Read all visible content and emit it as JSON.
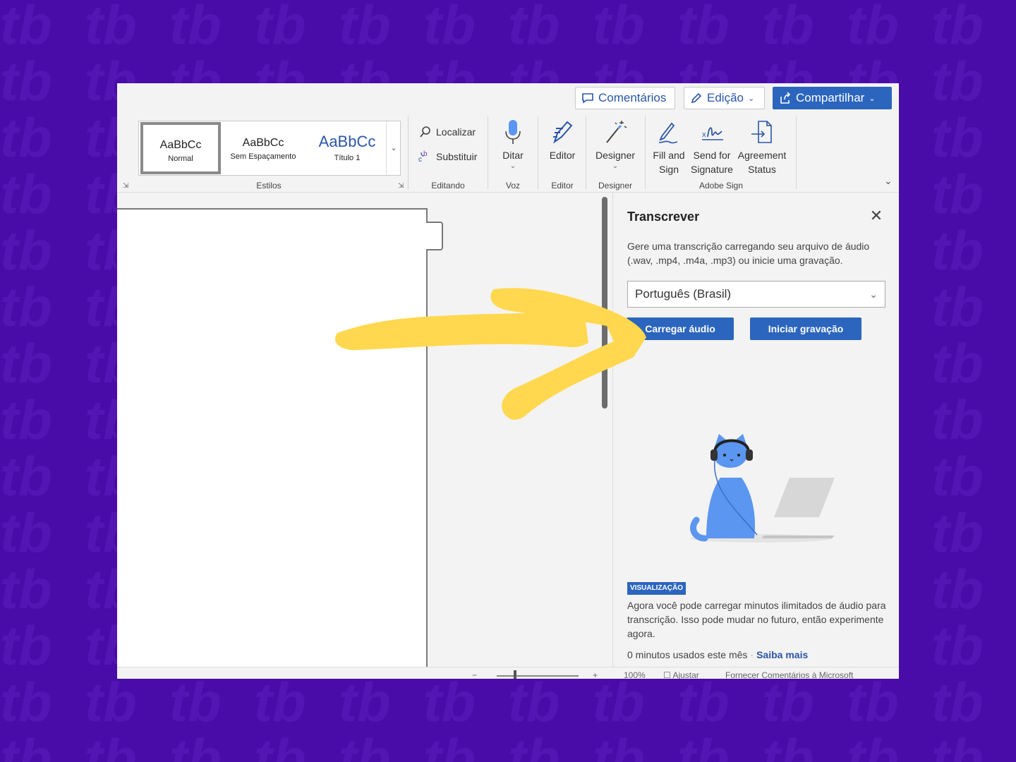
{
  "topbar": {
    "comments_label": "Comentários",
    "editing_label": "Edição",
    "share_label": "Compartilhar"
  },
  "ribbon": {
    "styles": [
      {
        "sample": "AaBbCc",
        "name": "Normal"
      },
      {
        "sample": "AaBbCc",
        "name": "Sem Espaçamento"
      },
      {
        "sample": "AaBbCc",
        "name": "Título 1"
      }
    ],
    "groups": {
      "styles": "Estilos",
      "editing": "Editando",
      "voice": "Voz",
      "editor": "Editor",
      "designer": "Designer",
      "adobe": "Adobe Sign"
    },
    "find_label": "Localizar",
    "replace_label": "Substituir",
    "dictate_label": "Ditar",
    "editor_label": "Editor",
    "designer_label": "Designer",
    "fill_sign": [
      "Fill and",
      "Sign"
    ],
    "send_sign": [
      "Send for",
      "Signature"
    ],
    "agreement": [
      "Agreement",
      "Status"
    ]
  },
  "panel": {
    "title": "Transcrever",
    "description": "Gere uma transcrição carregando seu arquivo de áudio (.wav, .mp4, .m4a, .mp3) ou inicie uma gravação.",
    "language": "Português (Brasil)",
    "upload_label": "Carregar áudio",
    "record_label": "Iniciar gravação",
    "preview_badge": "VISUALIZAÇÃO",
    "preview_text": "Agora você pode carregar minutos ilimitados de áudio para transcrição. Isso pode mudar no futuro, então experimente agora.",
    "usage": "0 minutos usados este mês",
    "learn_more": "Saiba mais"
  },
  "statusbar": {
    "minus": "−",
    "plus": "+",
    "zoom": "100%",
    "fit": "Ajustar",
    "feedback": "Fornecer Comentários à Microsoft"
  },
  "colors": {
    "background": "#4a0ca8",
    "accent_blue": "#2b65bd",
    "arrow_yellow": "#ffd84f",
    "cat_blue": "#5b96f0"
  }
}
